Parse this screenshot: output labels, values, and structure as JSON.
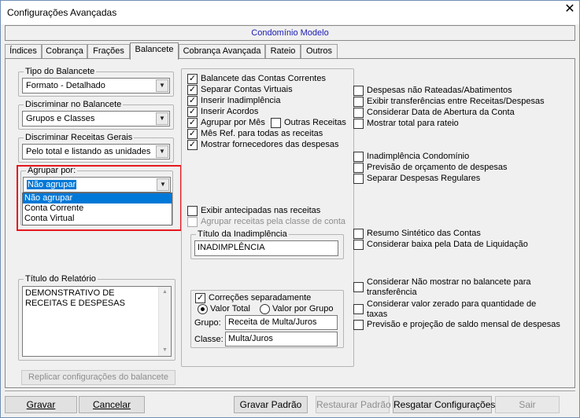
{
  "window": {
    "title": "Configurações Avançadas",
    "close_glyph": "✕"
  },
  "header": {
    "condominio": "Condomínio Modelo"
  },
  "tabs": [
    {
      "label": "Índices"
    },
    {
      "label": "Cobrança"
    },
    {
      "label": "Frações"
    },
    {
      "label": "Balancete"
    },
    {
      "label": "Cobrança Avançada"
    },
    {
      "label": "Rateio"
    },
    {
      "label": "Outros"
    }
  ],
  "active_tab": "Balancete",
  "left": {
    "tipo_balancete": {
      "label": "Tipo do Balancete",
      "value": "Formato - Detalhado"
    },
    "discriminar_balancete": {
      "label": "Discriminar no Balancete",
      "value": "Grupos e Classes"
    },
    "discriminar_receitas": {
      "label": "Discriminar Receitas Gerais",
      "value": "Pelo total e listando as unidades"
    },
    "agrupar_por": {
      "label": "Agrupar por:",
      "value": "Não agrupar",
      "options": [
        "Não agrupar",
        "Conta Corrente",
        "Conta Virtual"
      ]
    },
    "titulo_relatorio": {
      "label": "Título do Relatório",
      "value": "DEMONSTRATIVO DE RECEITAS E DESPESAS"
    },
    "replicar_button": "Replicar configurações do balancete"
  },
  "middle": {
    "checkboxes": [
      {
        "label": "Balancete das Contas Correntes",
        "checked": true
      },
      {
        "label": "Separar Contas Virtuais",
        "checked": true
      },
      {
        "label": "Inserir Inadimplência",
        "checked": true
      },
      {
        "label": "Inserir Acordos",
        "checked": true
      },
      {
        "label": "Agrupar por Mês",
        "checked": true
      },
      {
        "label": "Mês Ref. para todas as receitas",
        "checked": true
      },
      {
        "label": "Mostrar fornecedores das despesas",
        "checked": true
      }
    ],
    "outras_receitas": {
      "label": "Outras Receitas",
      "checked": false
    },
    "exibir_antecipadas": {
      "label": "Exibir antecipadas nas receitas",
      "checked": false
    },
    "agrupar_receitas_classe": {
      "label": "Agrupar receitas pela classe de conta",
      "checked": false,
      "disabled": true
    },
    "titulo_inadimplencia": {
      "label": "Título da Inadimplência",
      "value": "INADIMPLÊNCIA"
    },
    "correcoes": {
      "label": "Correções separadamente",
      "checked": true,
      "radio_total": "Valor Total",
      "radio_grupo": "Valor por Grupo",
      "selected": "Valor Total",
      "grupo_label": "Grupo:",
      "grupo_value": "Receita de Multa/Juros",
      "classe_label": "Classe:",
      "classe_value": "Multa/Juros"
    }
  },
  "right": {
    "checks_a": [
      {
        "label": "Despesas não Rateadas/Abatimentos",
        "checked": false
      },
      {
        "label": "Exibir transferências entre Receitas/Despesas",
        "checked": false
      },
      {
        "label": "Considerar Data de Abertura da Conta",
        "checked": false
      },
      {
        "label": "Mostrar total para rateio",
        "checked": false
      }
    ],
    "checks_b": [
      {
        "label": "Inadimplência Condomínio",
        "checked": false
      },
      {
        "label": "Previsão de orçamento de despesas",
        "checked": false
      },
      {
        "label": "Separar Despesas Regulares",
        "checked": false
      }
    ],
    "checks_c": [
      {
        "label": "Resumo Sintético das Contas",
        "checked": false
      },
      {
        "label": "Considerar baixa pela Data de Liquidação",
        "checked": false
      }
    ],
    "considerar_nao_mostrar": {
      "line1": "Considerar Não mostrar no balancete para",
      "line2": "transferência",
      "checked": false
    },
    "considerar_zerado": {
      "line1": "Considerar valor zerado para quantidade de",
      "line2": "taxas",
      "checked": false
    },
    "previsao_saldo": {
      "label": "Previsão e projeção de saldo mensal de despesas",
      "checked": false
    }
  },
  "footer": {
    "gravar": "Gravar",
    "cancelar": "Cancelar",
    "gravar_padrao": "Gravar Padrão",
    "restaurar_padrao": "Restaurar Padrão",
    "resgatar": "Resgatar Configurações",
    "sair": "Sair"
  },
  "colors": {
    "highlight": "#e5171e",
    "selection": "#0078d7",
    "condo_text": "#1a1ab4"
  },
  "icons": [
    "close-icon",
    "chevron-down-icon",
    "checkmark-icon",
    "scroll-up-icon",
    "scroll-down-icon"
  ]
}
